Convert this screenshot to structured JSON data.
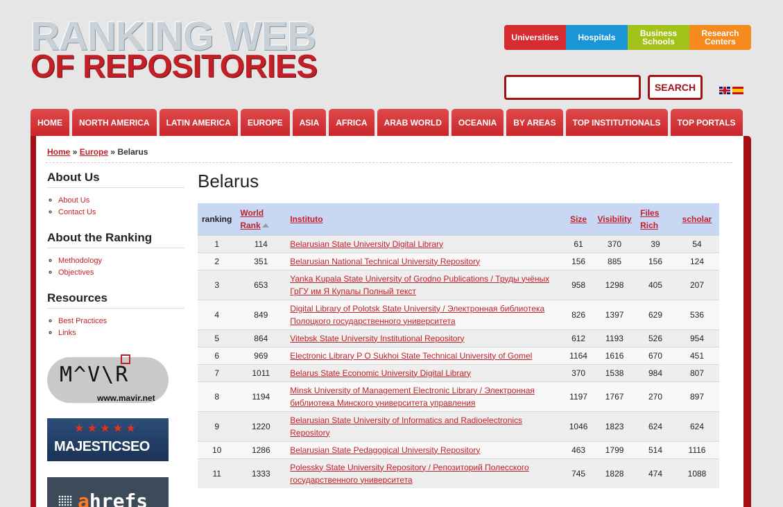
{
  "logo": {
    "line1": "RANKING WEB",
    "line2": "OF REPOSITORIES"
  },
  "categories": [
    {
      "label": "Universities",
      "color": "#d62b2f"
    },
    {
      "label": "Hospitals",
      "color": "#1a95d6"
    },
    {
      "label": "Business Schools",
      "color": "#a3c219"
    },
    {
      "label": "Research Centers",
      "color": "#f58a1f"
    }
  ],
  "search": {
    "button": "SEARCH",
    "placeholder": ""
  },
  "nav": [
    "HOME",
    "NORTH AMERICA",
    "LATIN AMERICA",
    "EUROPE",
    "ASIA",
    "AFRICA",
    "ARAB WORLD",
    "OCEANIA",
    "BY AREAS",
    "TOP INSTITUTIONALS",
    "TOP PORTALS"
  ],
  "breadcrumb": {
    "home": "Home",
    "sep1": "»",
    "europe": "Europe",
    "sep2": "»",
    "current": "Belarus"
  },
  "sidebar": {
    "about_title": "About Us",
    "about_links": [
      "About Us",
      "Contact Us"
    ],
    "ranking_title": "About the Ranking",
    "ranking_links": [
      "Methodology",
      "Objectives"
    ],
    "resources_title": "Resources",
    "resources_links": [
      "Best Practices",
      "Links"
    ],
    "mavir_word": "M^V\\R",
    "mavir_url": "www.mavir.net",
    "majestic": "MAJESTICSEO",
    "ahrefs_a": "a",
    "ahrefs_rest": "hrefs"
  },
  "page_title": "Belarus",
  "table": {
    "headers": {
      "ranking": "ranking",
      "world": "World",
      "rank": "Rank",
      "instituto": "Instituto",
      "size": "Size",
      "visibility": "Visibility",
      "files": "Files",
      "rich": "Rich",
      "scholar": "scholar"
    },
    "rows": [
      {
        "ranking": "1",
        "world_rank": "114",
        "name": "Belarusian State University Digital Library",
        "size": "61",
        "visibility": "370",
        "files_rich": "39",
        "scholar": "54"
      },
      {
        "ranking": "2",
        "world_rank": "351",
        "name": "Belarusian National Technical University Repository",
        "size": "156",
        "visibility": "885",
        "files_rich": "156",
        "scholar": "124"
      },
      {
        "ranking": "3",
        "world_rank": "653",
        "name": "Yanka Kupala State University of Grodno Publications / Труды учёных ГрГУ им Я Купалы Полный текст",
        "size": "958",
        "visibility": "1298",
        "files_rich": "405",
        "scholar": "207"
      },
      {
        "ranking": "4",
        "world_rank": "849",
        "name": "Digital Library of Polotsk State University / Электронная библиотека Полоцкого государственного университета",
        "size": "826",
        "visibility": "1397",
        "files_rich": "629",
        "scholar": "536"
      },
      {
        "ranking": "5",
        "world_rank": "864",
        "name": "Vitebsk State University Institutional Repository",
        "size": "612",
        "visibility": "1193",
        "files_rich": "526",
        "scholar": "954"
      },
      {
        "ranking": "6",
        "world_rank": "969",
        "name": "Electronic Library P O Sukhoi State Technical University of Gomel",
        "size": "1164",
        "visibility": "1616",
        "files_rich": "670",
        "scholar": "451"
      },
      {
        "ranking": "7",
        "world_rank": "1011",
        "name": "Belarus State Economic University Digital Library",
        "size": "370",
        "visibility": "1538",
        "files_rich": "984",
        "scholar": "807"
      },
      {
        "ranking": "8",
        "world_rank": "1194",
        "name": "Minsk University of Management Electronic Library / Электронная библиотека Минского университета управления",
        "size": "1197",
        "visibility": "1767",
        "files_rich": "270",
        "scholar": "897"
      },
      {
        "ranking": "9",
        "world_rank": "1220",
        "name": "Belarusian State University of Informatics and Radioelectronics Repository",
        "size": "1046",
        "visibility": "1823",
        "files_rich": "624",
        "scholar": "624"
      },
      {
        "ranking": "10",
        "world_rank": "1286",
        "name": "Belarusian State Pedagogical University Repository",
        "size": "463",
        "visibility": "1799",
        "files_rich": "514",
        "scholar": "1116"
      },
      {
        "ranking": "11",
        "world_rank": "1333",
        "name": "Polessky State University Repository / Репозиторий Полесского государственного университета",
        "size": "745",
        "visibility": "1828",
        "files_rich": "474",
        "scholar": "1088"
      }
    ]
  }
}
